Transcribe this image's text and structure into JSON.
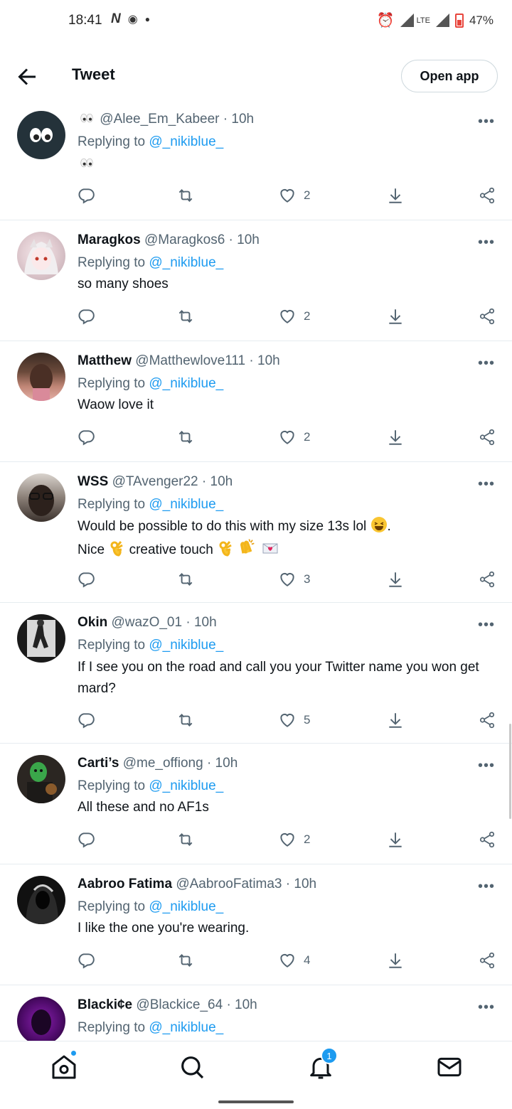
{
  "status_bar": {
    "time": "18:41",
    "network": "LTE",
    "battery": "47%"
  },
  "header": {
    "title": "Tweet",
    "open_app_label": "Open app"
  },
  "replies": [
    {
      "name": "",
      "name_prefix_emoji": "eyes-emoji",
      "handle": "@Alee_Em_Kabeer",
      "time": "· 10h",
      "replying_label": "Replying to",
      "replying_to": "@_nikiblue_",
      "text": "",
      "text_emoji": "eyes-emoji",
      "likes": "2"
    },
    {
      "name": "Maragkos",
      "handle": "@Maragkos6",
      "time": "· 10h",
      "replying_label": "Replying to",
      "replying_to": "@_nikiblue_",
      "text": "so many shoes",
      "likes": "2"
    },
    {
      "name": "Matthew",
      "handle": "@Matthewlove111",
      "time": "· 10h",
      "replying_label": "Replying to",
      "replying_to": "@_nikiblue_",
      "text": "Waow love it",
      "likes": "2"
    },
    {
      "name": "WSS",
      "handle": "@TAvenger22",
      "time": "· 10h",
      "replying_label": "Replying to",
      "replying_to": "@_nikiblue_",
      "text_line1": "Would be possible to do this with my size 13s lol",
      "text_line1_end": ".",
      "text_line2_a": "Nice",
      "text_line2_b": "creative touch",
      "likes": "3"
    },
    {
      "name": "Okin",
      "handle": "@wazO_01",
      "time": "· 10h",
      "replying_label": "Replying to",
      "replying_to": "@_nikiblue_",
      "text": "If I see you on the road and call you your Twitter name you won get mard?",
      "likes": "5"
    },
    {
      "name": "Carti’s",
      "handle": "@me_offiong",
      "time": "· 10h",
      "replying_label": "Replying to",
      "replying_to": "@_nikiblue_",
      "text": "All these and no AF1s",
      "likes": "2"
    },
    {
      "name": "Aabroo Fatima",
      "handle": "@AabrooFatima3",
      "time": "· 10h",
      "replying_label": "Replying to",
      "replying_to": "@_nikiblue_",
      "text": "I like the one you're wearing.",
      "likes": "4"
    },
    {
      "name": "Blacki¢e",
      "handle": "@Blackice_64",
      "time": "· 10h",
      "replying_label": "Replying to",
      "replying_to": "@_nikiblue_"
    }
  ],
  "more_label": "•••",
  "bottom_nav": {
    "notification_count": "1"
  },
  "colors": {
    "accent": "#1d9bf0",
    "text_primary": "#0f1419",
    "text_secondary": "#536471"
  }
}
